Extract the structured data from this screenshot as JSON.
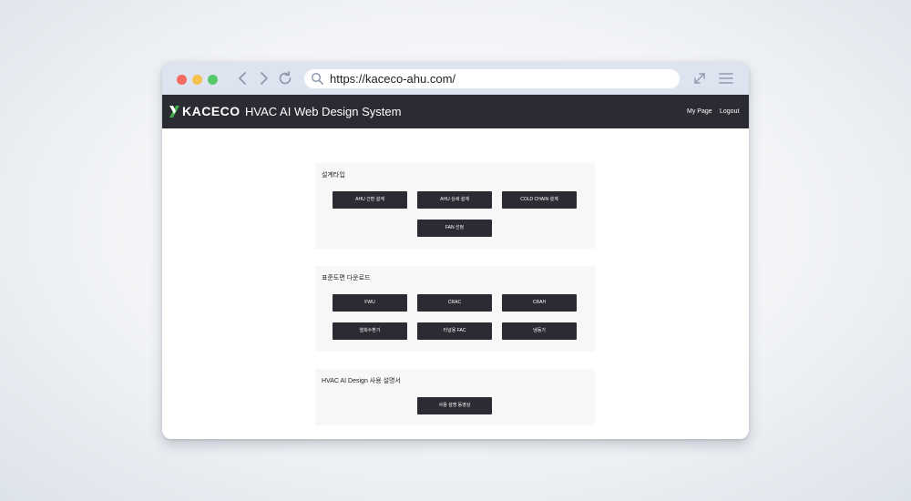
{
  "browser": {
    "url": "https://kaceco-ahu.com/"
  },
  "app": {
    "logo": "KACECO",
    "title": "HVAC AI Web Design System",
    "nav": {
      "mypage": "My Page",
      "logout": "Logout"
    },
    "colors": {
      "header_bg": "#2b2c33",
      "logo_green": "#3fae4a",
      "button_bg": "#2b2c33"
    }
  },
  "sections": [
    {
      "title": "설계타입",
      "buttons": [
        "AHU 간편 설계",
        "AHU 상세 설계",
        "COLD CHAIN 설계",
        "FAN 선정"
      ]
    },
    {
      "title": "표준도면 다운로드",
      "buttons": [
        "FWU",
        "CRAC",
        "CRAH",
        "열회수환기",
        "터널용 FAC",
        "냉동기"
      ]
    },
    {
      "title": "HVAC AI Design 사용 설명서",
      "buttons": [
        "사용 설명 동영상"
      ]
    }
  ]
}
